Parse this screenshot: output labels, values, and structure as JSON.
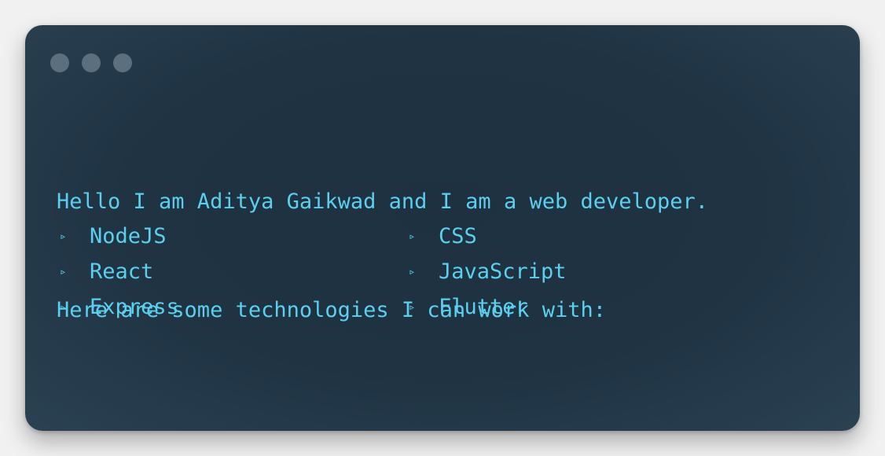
{
  "window": {
    "controls": [
      "window-dot",
      "window-dot",
      "window-dot"
    ]
  },
  "intro": {
    "line1": "Hello I am Aditya Gaikwad and I am a web developer.",
    "line2": "Here are some technologies I can work with:"
  },
  "technologies": {
    "left": [
      "NodeJS",
      "React",
      "Express"
    ],
    "right": [
      "CSS",
      "JavaScript",
      "Flutter"
    ],
    "bullet": "▹"
  },
  "colors": {
    "text": "#5ccfee",
    "window": "#1f3343",
    "dot": "#5c6f7f"
  }
}
